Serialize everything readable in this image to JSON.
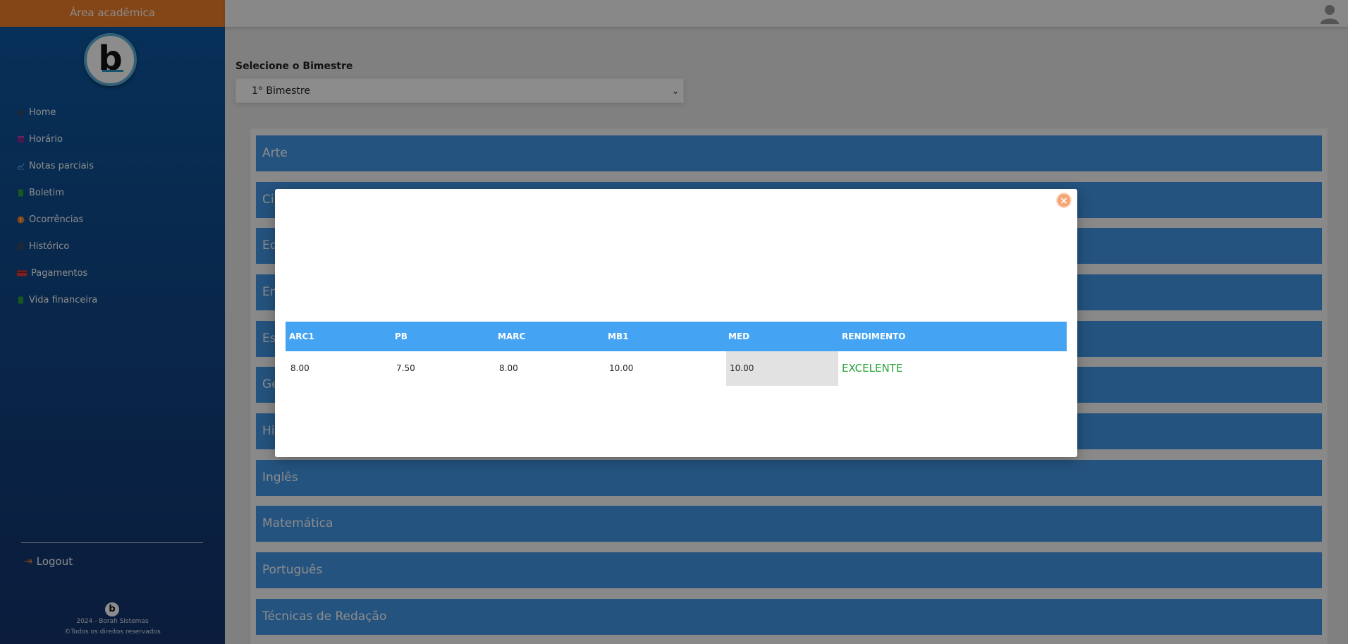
{
  "sidebar": {
    "header": "Área acadêmica",
    "logo_letter": "b",
    "items": [
      {
        "label": "Home",
        "icon": "home-icon",
        "color": "#3b4a5e"
      },
      {
        "label": "Horário",
        "icon": "calendar-icon",
        "color": "#8a2a8e"
      },
      {
        "label": "Notas parciais",
        "icon": "chart-icon",
        "color": "#4ea2e8"
      },
      {
        "label": "Boletim",
        "icon": "document-icon",
        "color": "#2aa33d"
      },
      {
        "label": "Ocorrências",
        "icon": "alert-icon",
        "color": "#f07f2a"
      },
      {
        "label": "Histórico",
        "icon": "history-icon",
        "color": "#3b4a5e"
      },
      {
        "label": "Pagamentos",
        "icon": "credit-card-icon",
        "color": "#e23b3b"
      },
      {
        "label": "Vida financeira",
        "icon": "finance-icon",
        "color": "#2aa33d"
      }
    ],
    "logout": "Logout",
    "footer_logo": "b",
    "footer_line1": "2024 - Borah Sistemas",
    "footer_line2": "©Todos os direitos reservados"
  },
  "main": {
    "select_label": "Selecione o Bimestre",
    "select_value": "1° Bimestre",
    "subjects": [
      "Arte",
      "Ci",
      "Ed",
      "En",
      "Es",
      "Ge",
      "Hi",
      "Inglês",
      "Matemática",
      "Português",
      "Técnicas de Redação"
    ]
  },
  "modal": {
    "columns": [
      "ARC1",
      "PB",
      "MARC",
      "MB1",
      "MED",
      "RENDIMENTO"
    ],
    "values": [
      "8.00",
      "7.50",
      "8.00",
      "10.00",
      "10.00",
      "EXCELENTE"
    ]
  },
  "colors": {
    "accent": "#f07f2a",
    "subject_bar": "#4298e8",
    "table_header": "#44a3f2",
    "rendimento_excellent": "#2aa33d"
  }
}
